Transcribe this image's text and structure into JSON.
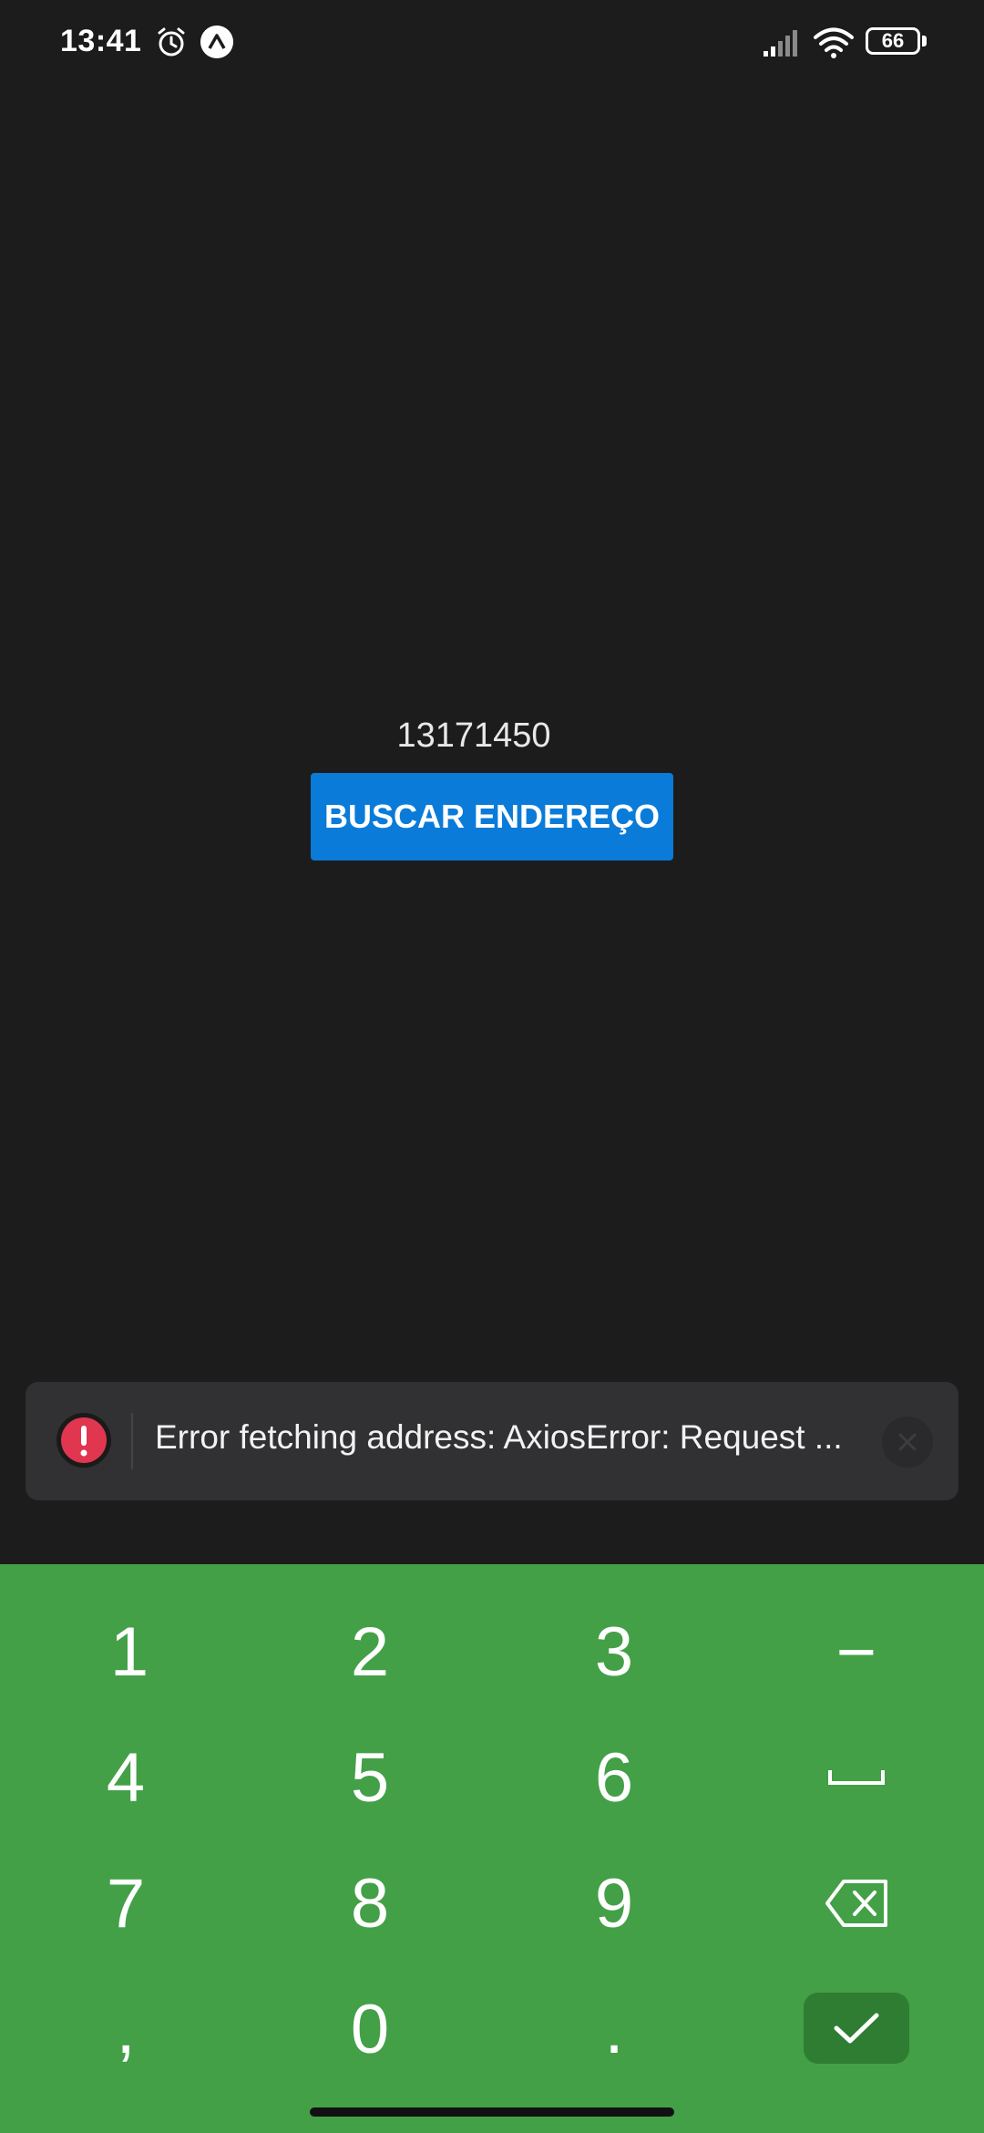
{
  "status_bar": {
    "time": "13:41",
    "battery": "66"
  },
  "main": {
    "cep_value": "13171450",
    "search_button_label": "BUSCAR ENDEREÇO"
  },
  "toast": {
    "message": "Error fetching address: AxiosError: Request ...",
    "icon": "error-icon",
    "accent": "#e0364f"
  },
  "keyboard": {
    "background": "#43a047",
    "keys": {
      "k1": "1",
      "k2": "2",
      "k3": "3",
      "minus": "−",
      "k4": "4",
      "k5": "5",
      "k6": "6",
      "k7": "7",
      "k8": "8",
      "k9": "9",
      "comma": ",",
      "k0": "0",
      "period": "."
    },
    "space_icon": "space-icon",
    "backspace_icon": "backspace-icon",
    "done_icon": "check-icon"
  },
  "colors": {
    "background": "#1c1c1d",
    "button": "#0a7bd8",
    "done_key": "#2e7d32"
  }
}
